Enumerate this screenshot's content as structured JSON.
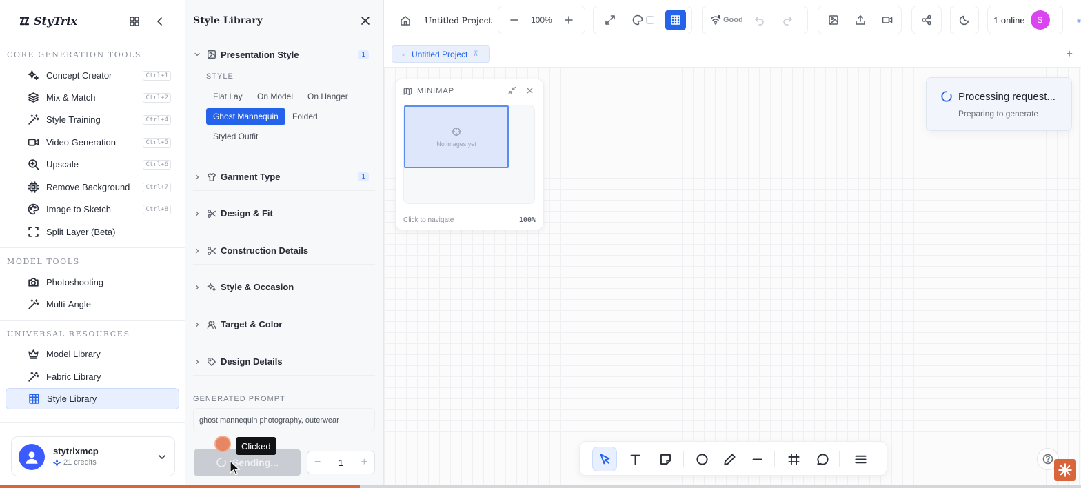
{
  "brand": {
    "name": "StyTrix"
  },
  "sidebar": {
    "sections": [
      {
        "title": "CORE GENERATION TOOLS",
        "items": [
          {
            "label": "Concept Creator",
            "shortcut": "Ctrl+1",
            "icon": "sparkles-icon"
          },
          {
            "label": "Mix & Match",
            "shortcut": "Ctrl+2",
            "icon": "layers-icon"
          },
          {
            "label": "Style Training",
            "shortcut": "Ctrl+4",
            "icon": "magic-wand-icon"
          },
          {
            "label": "Video Generation",
            "shortcut": "Ctrl+5",
            "icon": "video-icon"
          },
          {
            "label": "Upscale",
            "shortcut": "Ctrl+6",
            "icon": "zoom-in-icon"
          },
          {
            "label": "Remove Background",
            "shortcut": "Ctrl+7",
            "icon": "chip-icon"
          },
          {
            "label": "Image to Sketch",
            "shortcut": "Ctrl+8",
            "icon": "palette-icon"
          },
          {
            "label": "Split Layer (Beta)",
            "shortcut": "",
            "icon": "scan-icon"
          }
        ]
      },
      {
        "title": "MODEL TOOLS",
        "items": [
          {
            "label": "Photoshooting",
            "icon": "camera-icon"
          },
          {
            "label": "Multi-Angle",
            "icon": "magic-wand-icon"
          }
        ]
      },
      {
        "title": "UNIVERSAL RESOURCES",
        "items": [
          {
            "label": "Model Library",
            "icon": "crown-icon"
          },
          {
            "label": "Fabric Library",
            "icon": "magic-wand-icon"
          },
          {
            "label": "Style Library",
            "icon": "grid-icon",
            "active": true
          }
        ]
      }
    ],
    "user": {
      "name": "stytrixmcp",
      "credits": "21 credits"
    }
  },
  "panel": {
    "title": "Style Library",
    "accordions": [
      {
        "label": "Presentation Style",
        "badge": "1",
        "expanded": true
      },
      {
        "label": "Garment Type",
        "badge": "1"
      },
      {
        "label": "Design & Fit"
      },
      {
        "label": "Construction Details"
      },
      {
        "label": "Style & Occasion"
      },
      {
        "label": "Target & Color"
      },
      {
        "label": "Design Details"
      }
    ],
    "style_label": "STYLE",
    "chips": [
      "Flat Lay",
      "On Model",
      "On Hanger",
      "Ghost Mannequin",
      "Folded",
      "Styled Outfit"
    ],
    "selected_chip": "Ghost Mannequin",
    "generated_prompt_label": "GENERATED PROMPT",
    "generated_prompt": "ghost mannequin photography, outerwear",
    "send_label": "Sending...",
    "quantity": "1",
    "tooltip": "Clicked"
  },
  "topbar": {
    "project_name": "Untitled Project",
    "zoom": "100%",
    "connection": "Good",
    "online": "1 online",
    "avatar_initial": "S"
  },
  "tabs": {
    "project_tab": "Untitled Project"
  },
  "minimap": {
    "title": "MINIMAP",
    "empty": "No images yet",
    "footer": "Click to navigate",
    "zoom": "100%"
  },
  "toast": {
    "title": "Processing request...",
    "subtitle": "Preparing to generate"
  },
  "progress": {
    "value": 0.333
  },
  "colors": {
    "accent": "#2563eb",
    "brand_orange": "#d9653a",
    "avatar_pink": "#d946ef"
  }
}
